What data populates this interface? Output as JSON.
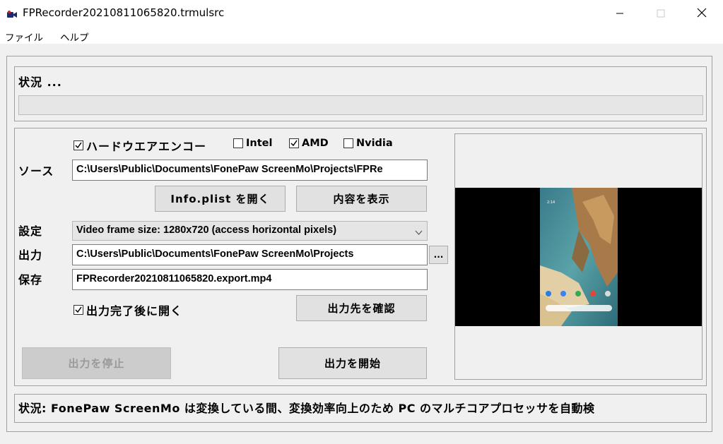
{
  "window": {
    "title": "FPRecorder20210811065820.trmulsrc",
    "icon": "video-camera-icon",
    "minimize_icon": "minimize-icon",
    "maximize_icon": "maximize-icon",
    "close_icon": "close-icon"
  },
  "menu": {
    "items": [
      {
        "label": "ファイル"
      },
      {
        "label": "ヘルプ"
      }
    ]
  },
  "status": {
    "label": "状況 ...",
    "progress": 0
  },
  "encoder": {
    "hardware_label": "ハードウエアエンコー",
    "hardware_checked": true,
    "intel_label": "Intel",
    "intel_checked": false,
    "amd_label": "AMD",
    "amd_checked": true,
    "nvidia_label": "Nvidia",
    "nvidia_checked": false
  },
  "source": {
    "label": "ソース",
    "value": "C:\\Users\\Public\\Documents\\FonePaw ScreenMo\\Projects\\FPRe",
    "open_plist_label": "Info.plist を開く",
    "show_contents_label": "内容を表示"
  },
  "settings": {
    "label": "設定",
    "selected": "Video frame size: 1280x720 (access horizontal pixels)"
  },
  "output": {
    "label": "出力",
    "value": "C:\\Users\\Public\\Documents\\FonePaw ScreenMo\\Projects",
    "browse_label": "..."
  },
  "save": {
    "label": "保存",
    "value": "FPRecorder20210811065820.export.mp4"
  },
  "open_after": {
    "label": "出力完了後に開く",
    "checked": true
  },
  "buttons": {
    "confirm_output_label": "出力先を確認",
    "stop_output_label": "出力を停止",
    "start_output_label": "出力を開始"
  },
  "bottom_status": {
    "text": "状況: FonePaw ScreenMo は変換している間、変換効率向上のため PC のマルチコアプロセッサを自動検"
  },
  "colors": {
    "accent_check": "#000000",
    "window_bg": "#f0f0f0",
    "preview_bg": "#000000"
  }
}
